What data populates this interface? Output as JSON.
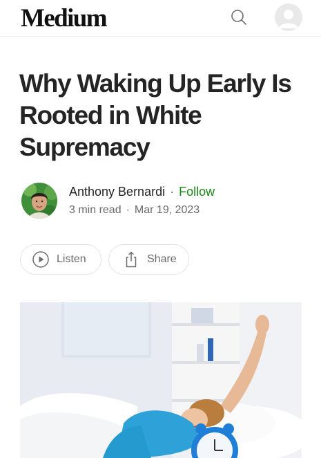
{
  "header": {
    "logo": "Medium",
    "search_icon": "search-icon",
    "profile_icon": "user-avatar-icon"
  },
  "article": {
    "title": "Why Waking Up Early Is Rooted in White Supremacy",
    "author": "Anthony Bernardi",
    "follow_label": "Follow",
    "read_time": "3 min read",
    "date": "Mar 19, 2023"
  },
  "actions": {
    "listen_label": "Listen",
    "listen_icon": "play-circle-icon",
    "share_label": "Share",
    "share_icon": "share-icon"
  },
  "hero_image": {
    "subject": "woman-stretching-in-bed-with-alarm-clock"
  },
  "colors": {
    "follow_green": "#1a8917",
    "text_primary": "#242424",
    "text_secondary": "#6b6b6b",
    "alarm_clock_blue": "#1f7fd6",
    "shirt_blue": "#2ea1d8"
  }
}
